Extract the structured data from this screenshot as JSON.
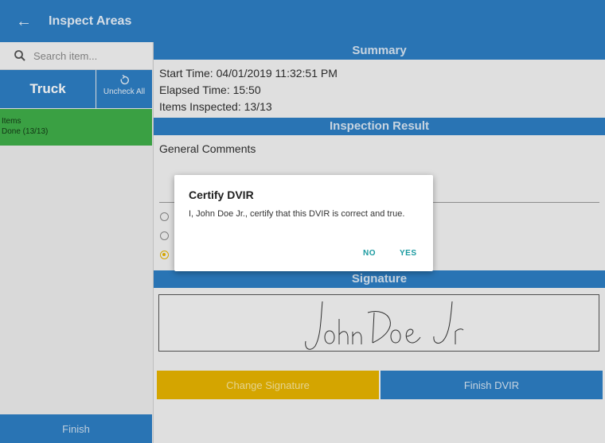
{
  "appbar": {
    "back_icon": "arrow-left-icon",
    "title": "Inspect Areas"
  },
  "sidebar": {
    "search": {
      "placeholder": "Search item..."
    },
    "truck_label": "Truck",
    "uncheck_label": "Uncheck All",
    "items": [
      {
        "title": "Items",
        "status": "Done (13/13)"
      }
    ],
    "finish_label": "Finish"
  },
  "summary": {
    "header": "Summary",
    "start_time": "Start Time: 04/01/2019 11:32:51 PM",
    "elapsed_time": "Elapsed Time: 15:50",
    "items_inspected": "Items Inspected: 13/13"
  },
  "result": {
    "header": "Inspection Result",
    "comments_label": "General Comments",
    "selected_index": 2
  },
  "signature": {
    "header": "Signature",
    "signed_name": "John Doe Jr",
    "change_label": "Change Signature",
    "finish_label": "Finish DVIR"
  },
  "dialog": {
    "title": "Certify DVIR",
    "message": "I, John Doe Jr., certify that this DVIR is correct and true.",
    "no_label": "NO",
    "yes_label": "YES"
  },
  "colors": {
    "primary": "#2d7ec4",
    "accent": "#e7b400",
    "done": "#3fae49",
    "dialog_button": "#1a9aa0"
  }
}
